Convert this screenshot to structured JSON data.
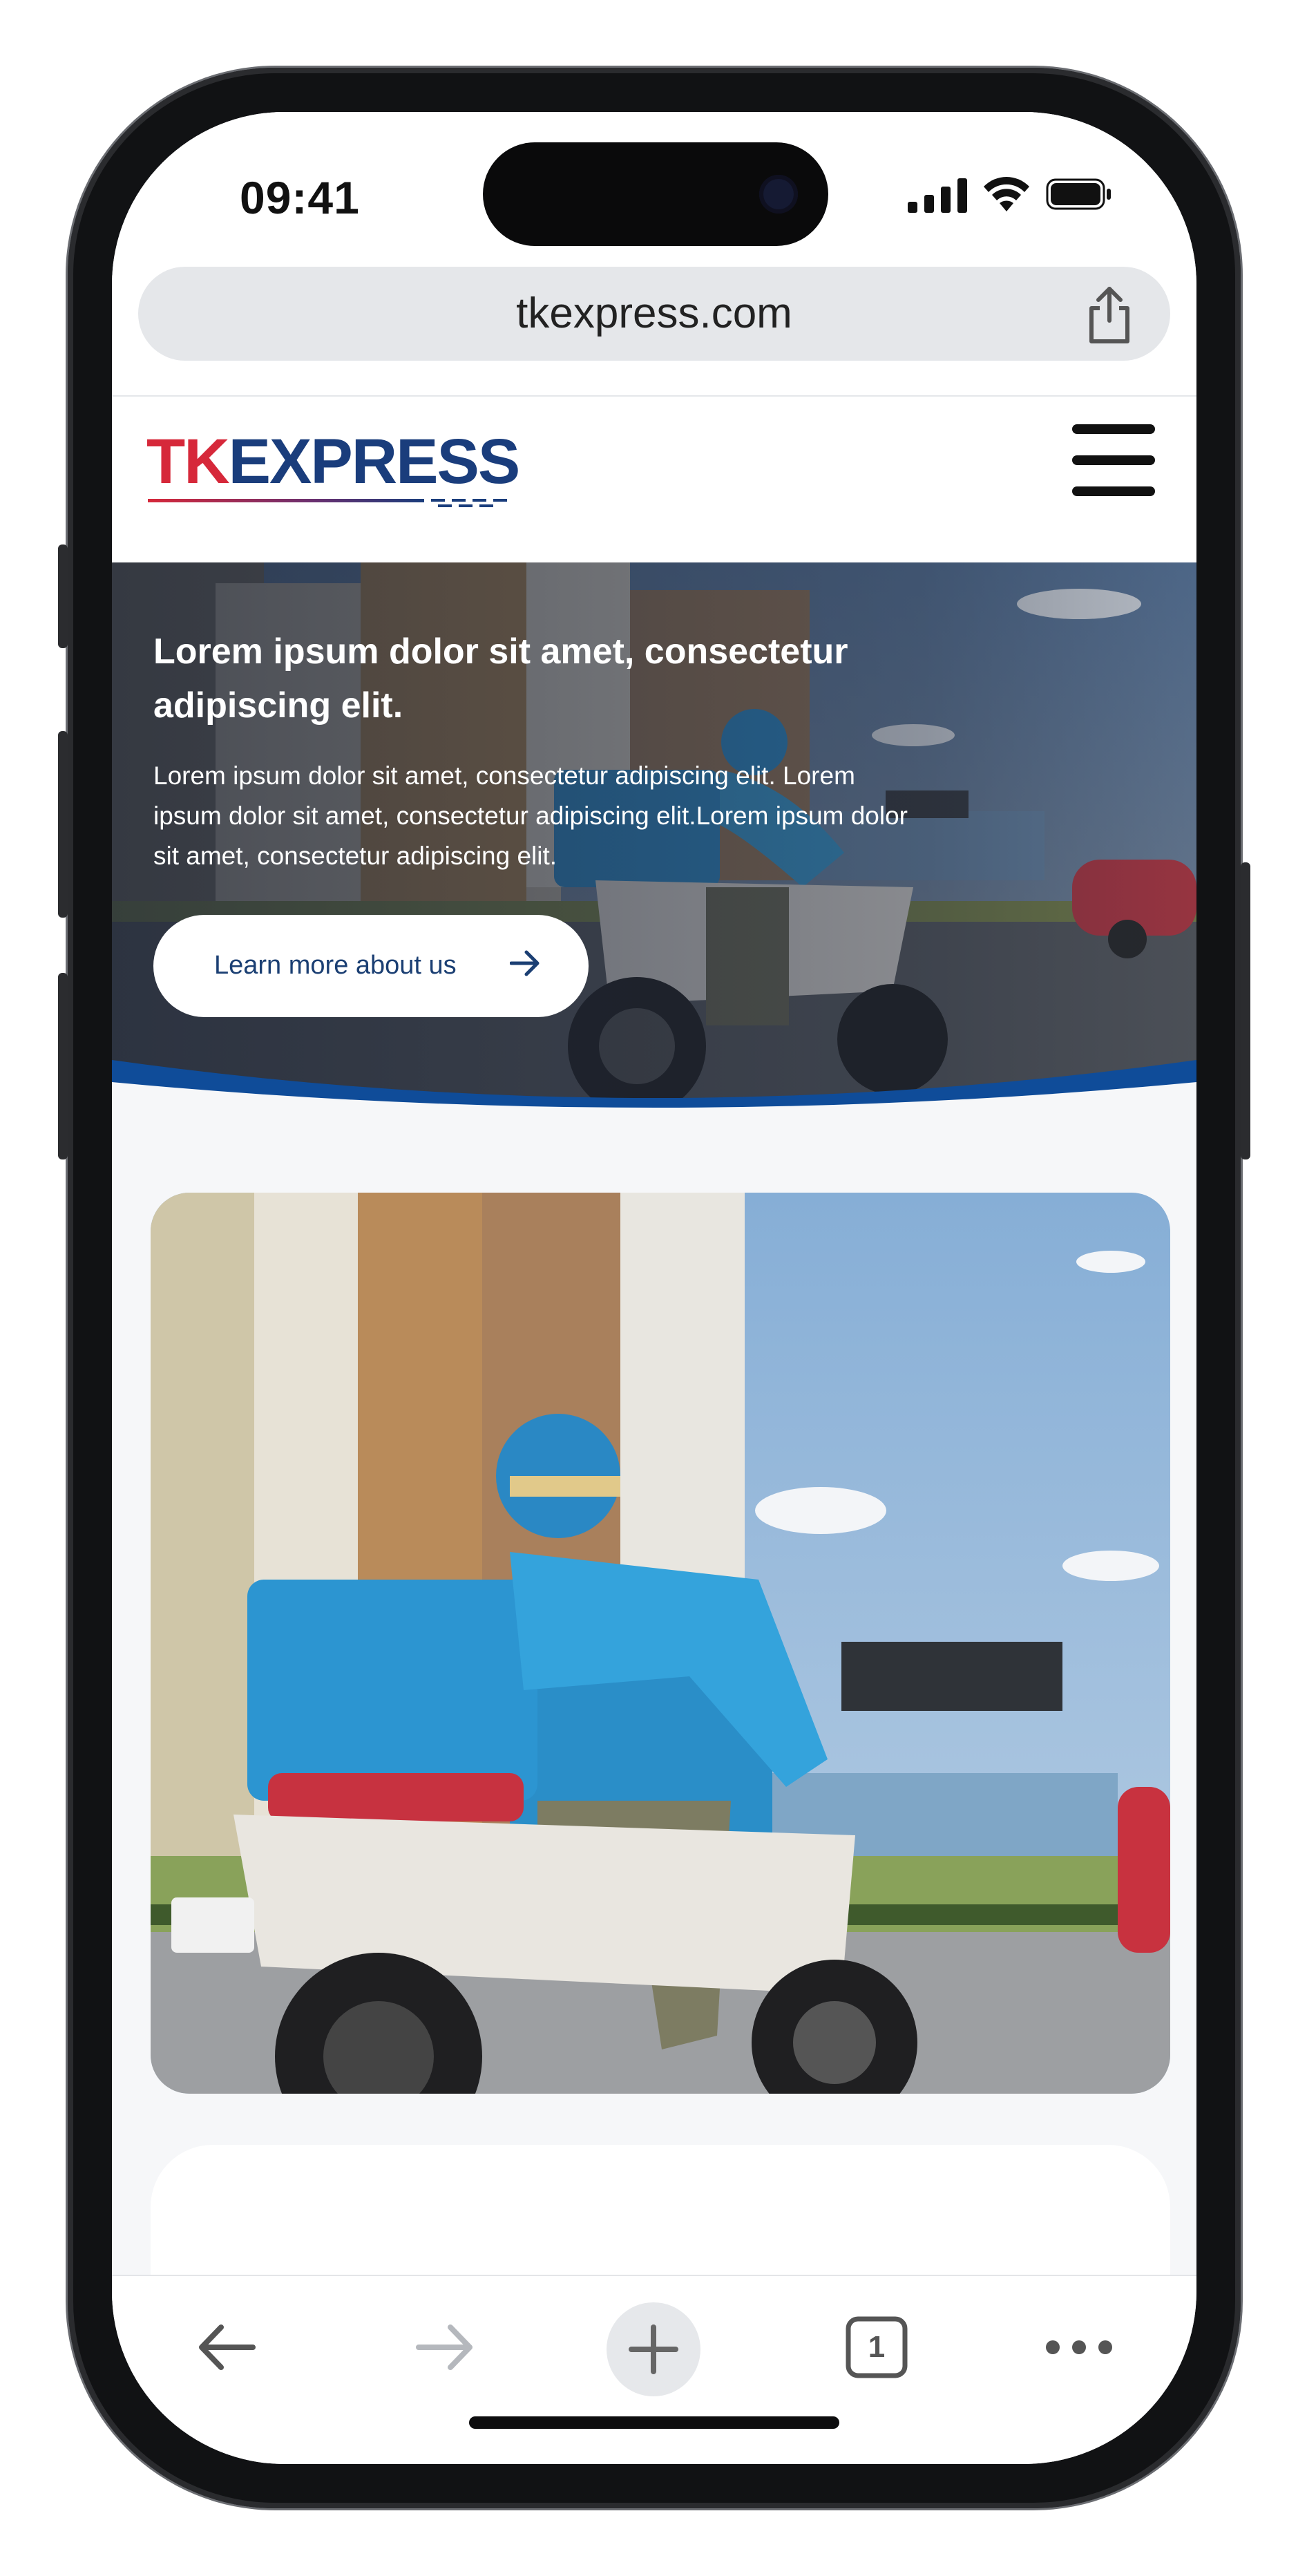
{
  "status_bar": {
    "time": "09:41"
  },
  "browser": {
    "url": "tkexpress.com",
    "tab_count": "1"
  },
  "site": {
    "logo": {
      "tk": "TK",
      "express": "EXPRESS",
      "colors": {
        "tk": "#d6283a",
        "express": "#1a3d7c"
      }
    },
    "menu_icon": "hamburger-icon"
  },
  "hero": {
    "title": "Lorem ipsum dolor sit amet, consectetur adipiscing elit.",
    "text": "Lorem ipsum dolor sit amet, consectetur adipiscing elit. Lorem ipsum dolor sit amet, consectetur adipiscing elit.Lorem ipsum dolor sit amet, consectetur adipiscing elit.",
    "button_label": "Learn more about us",
    "accent_color": "#0f4c99"
  },
  "toolbar": {
    "icons": [
      "back-icon",
      "forward-icon",
      "new-tab-icon",
      "tabs-icon",
      "more-icon"
    ]
  }
}
